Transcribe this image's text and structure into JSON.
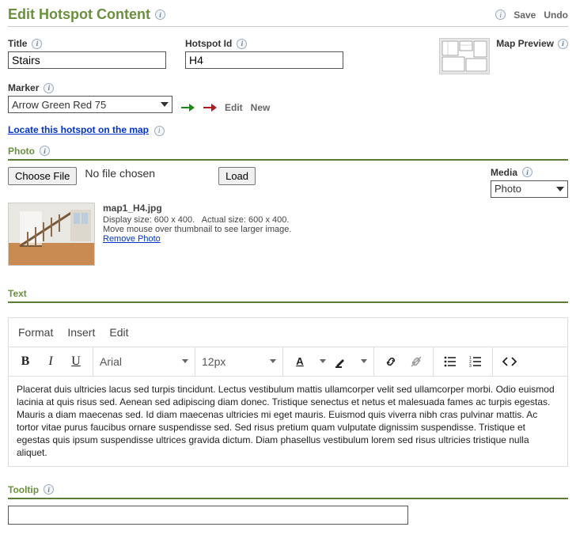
{
  "header": {
    "title": "Edit Hotspot Content",
    "save": "Save",
    "undo": "Undo"
  },
  "fields": {
    "title_label": "Title",
    "title_value": "Stairs",
    "hotspot_label": "Hotspot Id",
    "hotspot_value": "H4",
    "map_preview_label": "Map Preview",
    "marker_label": "Marker",
    "marker_value": "Arrow Green Red 75",
    "marker_edit": "Edit",
    "marker_new": "New",
    "locate_link": "Locate this hotspot on the map"
  },
  "photo": {
    "section": "Photo",
    "choose": "Choose File",
    "nofile": "No file chosen",
    "load": "Load",
    "media_label": "Media",
    "media_value": "Photo",
    "filename": "map1_H4.jpg",
    "display_size": "Display size: 600 x 400.",
    "actual_size": "Actual size: 600 x 400.",
    "hover_hint": "Move mouse over thumbnail to see larger image.",
    "remove": "Remove Photo"
  },
  "text_section": {
    "label": "Text",
    "menus": {
      "format": "Format",
      "insert": "Insert",
      "edit": "Edit"
    },
    "font": "Arial",
    "size": "12px",
    "content": "Placerat duis ultricies lacus sed turpis tincidunt. Lectus vestibulum mattis ullamcorper velit sed ullamcorper morbi. Odio euismod lacinia at quis risus sed. Aenean sed adipiscing diam donec. Tristique senectus et netus et malesuada fames ac turpis egestas. Mauris a diam maecenas sed. Id diam maecenas ultricies mi eget mauris. Euismod quis viverra nibh cras pulvinar mattis. Ac tortor vitae purus faucibus ornare suspendisse sed. Sed risus pretium quam vulputate dignissim suspendisse. Tristique et egestas quis ipsum suspendisse ultrices gravida dictum. Diam phasellus vestibulum lorem sed risus ultricies tristique nulla aliquet."
  },
  "tooltip": {
    "label": "Tooltip",
    "value": ""
  }
}
